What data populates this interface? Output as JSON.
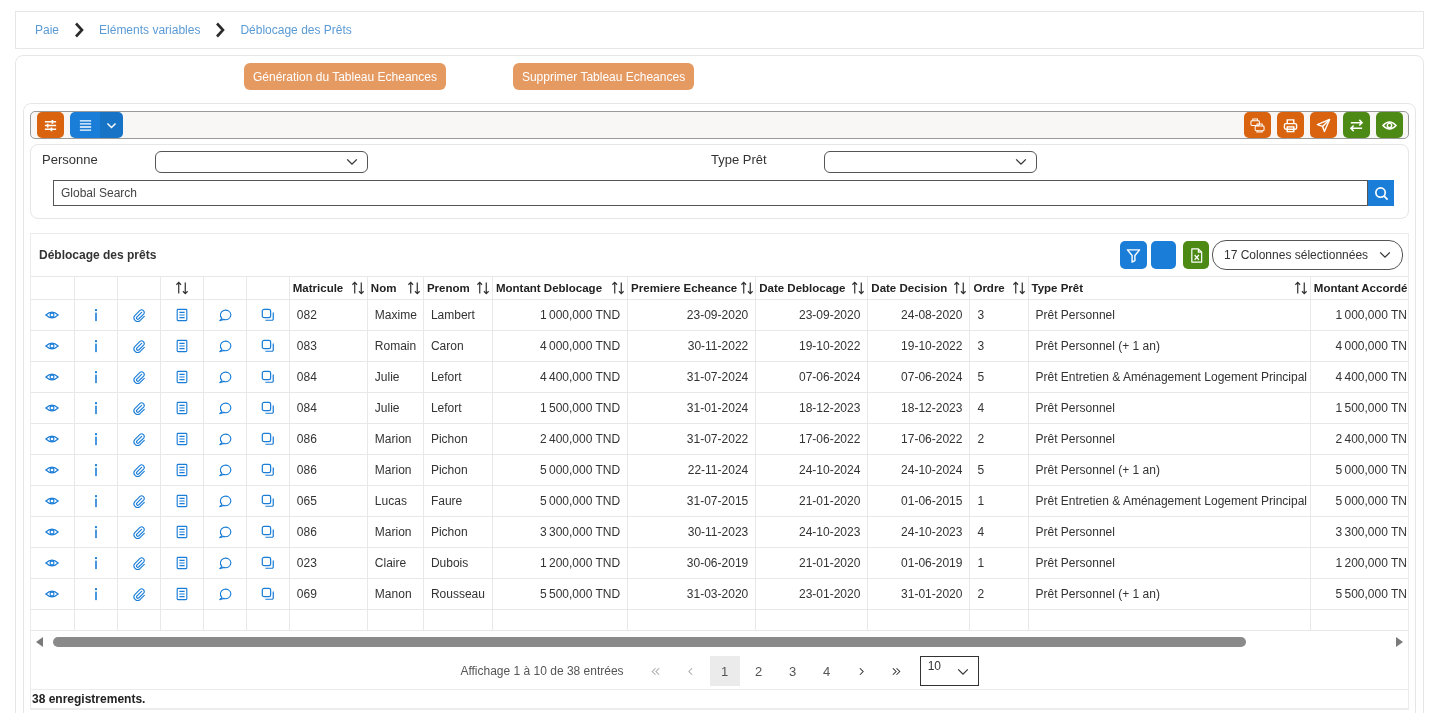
{
  "breadcrumb": [
    {
      "label": "Paie"
    },
    {
      "label": "Eléments variables"
    },
    {
      "label": "Déblocage des Prêts"
    }
  ],
  "actions": [
    "Génération du Tableau Echeances",
    "Supprimer Tableau Echeances"
  ],
  "toolbar": {
    "left": [
      {
        "kind": "sliders",
        "color": "#d9630e"
      },
      {
        "kind": "list-menu",
        "color": "#1a7dd7"
      }
    ],
    "right": [
      {
        "kind": "printers",
        "color": "#d9630e"
      },
      {
        "kind": "print",
        "color": "#d9630e"
      },
      {
        "kind": "send",
        "color": "#d9630e"
      },
      {
        "kind": "swap",
        "color": "#4c8a15"
      },
      {
        "kind": "view",
        "color": "#4c8a15"
      }
    ]
  },
  "filters": [
    {
      "label": "Personne"
    },
    {
      "label": "Type Prêt"
    }
  ],
  "search": {
    "placeholder": "Global Search"
  },
  "table": {
    "title": "Déblocage des prêts",
    "tools": [
      {
        "kind": "filter",
        "color": "#1a7dd7"
      },
      {
        "kind": "blank",
        "color": "#1a7dd7"
      },
      {
        "kind": "excel",
        "color": "#4c8a15"
      }
    ],
    "column_picker": "17 Colonnes sélectionnées",
    "action_columns": [
      {
        "kind": "view",
        "sortable": false
      },
      {
        "kind": "info",
        "sortable": false
      },
      {
        "kind": "attach",
        "sortable": false
      },
      {
        "kind": "document",
        "sortable": true
      },
      {
        "kind": "comment",
        "sortable": false
      },
      {
        "kind": "copy",
        "sortable": false
      }
    ],
    "columns": [
      {
        "label": "Matricule",
        "kind": "text",
        "sortable": true
      },
      {
        "label": "Nom",
        "kind": "text",
        "sortable": true
      },
      {
        "label": "Prenom",
        "kind": "text",
        "sortable": true
      },
      {
        "label": "Montant Deblocage",
        "kind": "amount",
        "sortable": true
      },
      {
        "label": "Premiere Echeance",
        "kind": "date",
        "sortable": true
      },
      {
        "label": "Date Deblocage",
        "kind": "date",
        "sortable": true
      },
      {
        "label": "Date Decision",
        "kind": "date",
        "sortable": true
      },
      {
        "label": "Ordre",
        "kind": "text",
        "sortable": true
      },
      {
        "label": "Type Prêt",
        "kind": "text",
        "sortable": true
      },
      {
        "label": "Montant Accordé",
        "kind": "amount"
      }
    ],
    "rows": [
      {
        "cells": [
          "082",
          "Maxime",
          "Lambert",
          "1 000,000 TND",
          "23-09-2020",
          "23-09-2020",
          "24-08-2020",
          "3",
          "Prêt Personnel",
          "1 000,000 TN"
        ]
      },
      {
        "cells": [
          "083",
          "Romain",
          "Caron",
          "4 000,000 TND",
          "30-11-2022",
          "19-10-2022",
          "19-10-2022",
          "3",
          "Prêt Personnel (+ 1 an)",
          "4 000,000 TN"
        ]
      },
      {
        "cells": [
          "084",
          "Julie",
          "Lefort",
          "4 400,000 TND",
          "31-07-2024",
          "07-06-2024",
          "07-06-2024",
          "5",
          "Prêt Entretien & Aménagement Logement Principal",
          "4 400,000 TN"
        ]
      },
      {
        "cells": [
          "084",
          "Julie",
          "Lefort",
          "1 500,000 TND",
          "31-01-2024",
          "18-12-2023",
          "18-12-2023",
          "4",
          "Prêt Personnel",
          "1 500,000 TN"
        ]
      },
      {
        "cells": [
          "086",
          "Marion",
          "Pichon",
          "2 400,000 TND",
          "31-07-2022",
          "17-06-2022",
          "17-06-2022",
          "2",
          "Prêt Personnel",
          "2 400,000 TN"
        ]
      },
      {
        "cells": [
          "086",
          "Marion",
          "Pichon",
          "5 000,000 TND",
          "22-11-2024",
          "24-10-2024",
          "24-10-2024",
          "5",
          "Prêt Personnel (+ 1 an)",
          "5 000,000 TN"
        ]
      },
      {
        "cells": [
          "065",
          "Lucas",
          "Faure",
          "5 000,000 TND",
          "31-07-2015",
          "21-01-2020",
          "01-06-2015",
          "1",
          "Prêt Entretien & Aménagement Logement Principal",
          "5 000,000 TN"
        ]
      },
      {
        "cells": [
          "086",
          "Marion",
          "Pichon",
          "3 300,000 TND",
          "30-11-2023",
          "24-10-2023",
          "24-10-2023",
          "4",
          "Prêt Personnel",
          "3 300,000 TN"
        ]
      },
      {
        "cells": [
          "023",
          "Claire",
          "Dubois",
          "1 200,000 TND",
          "30-06-2019",
          "21-01-2020",
          "01-06-2019",
          "1",
          "Prêt Personnel",
          "1 200,000 TN"
        ]
      },
      {
        "cells": [
          "069",
          "Manon",
          "Rousseau",
          "5 500,000 TND",
          "31-03-2020",
          "23-01-2020",
          "31-01-2020",
          "2",
          "Prêt Personnel (+ 1 an)",
          "5 500,000 TN"
        ]
      }
    ]
  },
  "pagination": {
    "summary": "Affichage 1 à 10 de 38 entrées",
    "before": [
      {
        "kind": "first",
        "disabled": true
      },
      {
        "kind": "prev",
        "disabled": true
      }
    ],
    "pages": [
      {
        "label": "1",
        "selected": true
      },
      {
        "label": "2",
        "selected": false
      },
      {
        "label": "3",
        "selected": false
      },
      {
        "label": "4",
        "selected": false
      }
    ],
    "after": [
      {
        "kind": "next",
        "disabled": false
      },
      {
        "kind": "last",
        "disabled": false
      }
    ],
    "page_size": "10"
  },
  "record_count": "38 enregistrements."
}
